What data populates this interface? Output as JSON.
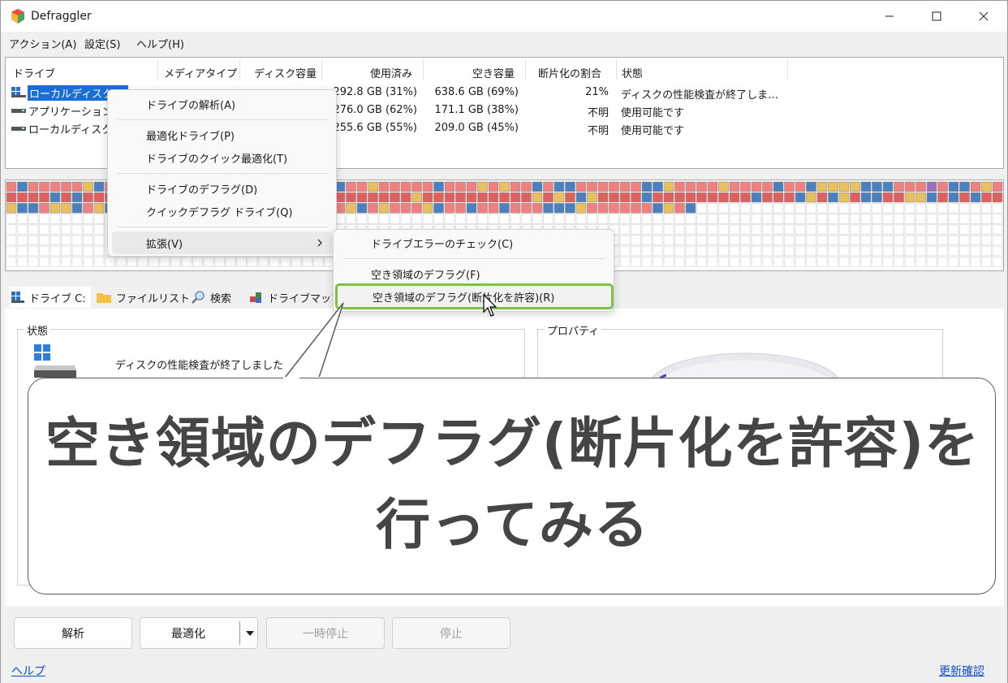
{
  "window": {
    "title": "Defraggler"
  },
  "menu": [
    "アクション(A)",
    "設定(S)",
    "ヘルプ(H)"
  ],
  "drive_list": {
    "columns": [
      "ドライブ",
      "メディアタイプ",
      "ディスク容量",
      "使用済み",
      "空き容量",
      "断片化の割合",
      "状態"
    ],
    "rows": [
      {
        "drive": "ローカルディスク (C:)",
        "media": "",
        "capacity": "",
        "used": "292.8 GB (31%)",
        "free": "638.6 GB (69%)",
        "frag": "21%",
        "status": "ディスクの性能検査が終了しま…",
        "selected": true
      },
      {
        "drive": "アプリケーション (",
        "media": "",
        "capacity": "",
        "used": "276.0 GB (62%)",
        "free": "171.1 GB (38%)",
        "frag": "不明",
        "status": "使用可能です",
        "selected": false
      },
      {
        "drive": "ローカルディスク (",
        "media": "",
        "capacity": "",
        "used": "255.6 GB (55%)",
        "free": "209.0 GB (45%)",
        "frag": "不明",
        "status": "使用可能です",
        "selected": false
      }
    ]
  },
  "tabs": [
    "ドライブ C:",
    "ファイルリスト",
    "検索",
    "ドライブマップ"
  ],
  "status_panel": {
    "title": "状態",
    "message": "ディスクの性能検査が終了しました"
  },
  "properties_panel": {
    "title": "プロパティ"
  },
  "context_menu": {
    "items": [
      "ドライブの解析(A)",
      "最適化ドライブ(P)",
      "ドライブのクイック最適化(T)",
      "ドライブのデフラグ(D)",
      "クイックデフラグ ドライブ(Q)",
      "拡張(V)"
    ]
  },
  "submenu": {
    "items": [
      "ドライブエラーのチェック(C)",
      "空き領域のデフラグ(F)",
      "空き領域のデフラグ(断片化を許容)(R)"
    ],
    "highlight_color": "#7dc243"
  },
  "buttons": {
    "analyze": "解析",
    "optimize": "最適化",
    "pause": "一時停止",
    "stop": "停止"
  },
  "footer": {
    "help": "ヘルプ",
    "update": "更新確認"
  },
  "callout": {
    "line1": "空き領域のデフラグ(断片化を許容)を",
    "line2": "行ってみる"
  },
  "colors": {
    "used": "#f08080",
    "fragmented": "#e06060",
    "system": "#4a7fc0",
    "reserved": "#e8c060",
    "empty": "#ffffff",
    "mft": "#9a70c0"
  }
}
